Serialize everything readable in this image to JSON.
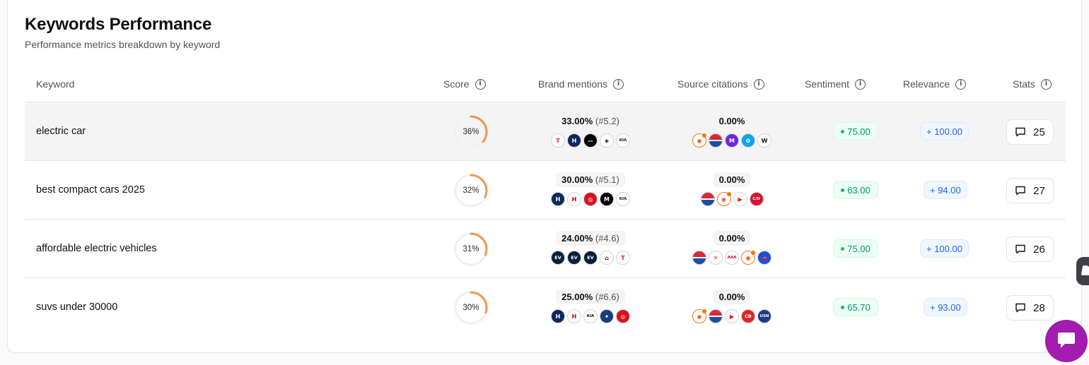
{
  "header": {
    "title": "Keywords Performance",
    "subtitle": "Performance metrics breakdown by keyword"
  },
  "columns": {
    "keyword": "Keyword",
    "score": "Score",
    "brand_mentions": "Brand mentions",
    "source_citations": "Source citations",
    "sentiment": "Sentiment",
    "relevance": "Relevance",
    "stats": "Stats"
  },
  "colors": {
    "score_ring": "#f4954f",
    "score_track": "#f1f1f3",
    "sentiment_green": "#059669",
    "relevance_blue": "#2563eb",
    "chat_fab": "#a21caf"
  },
  "rows": [
    {
      "keyword": "electric car",
      "score": 36,
      "score_label": "36%",
      "mentions": "33.00%",
      "mentions_rank": "(#5.2)",
      "brand_logos": [
        "tesla-logo",
        "hyundai-logo",
        "nissan-logo",
        "polestar-logo",
        "kia-logo"
      ],
      "citations": "0.00%",
      "source_logos": [
        "reddit-logo",
        "edmunds-logo",
        "motortrend-logo",
        "carwow-logo",
        "wikipedia-logo"
      ],
      "sentiment": "75.00",
      "relevance": "+ 100.00",
      "stats": "25"
    },
    {
      "keyword": "best compact cars 2025",
      "score": 32,
      "score_label": "32%",
      "mentions": "30.00%",
      "mentions_rank": "(#5.1)",
      "brand_logos": [
        "hyundai-logo",
        "honda-logo",
        "toyota-logo",
        "mazda-logo",
        "kia-logo"
      ],
      "citations": "0.00%",
      "source_logos": [
        "edmunds-logo",
        "reddit-logo",
        "youtube-logo",
        "caranddriver-logo"
      ],
      "sentiment": "63.00",
      "relevance": "+ 94.00",
      "stats": "27"
    },
    {
      "keyword": "affordable electric vehicles",
      "score": 31,
      "score_label": "31%",
      "mentions": "24.00%",
      "mentions_rank": "(#4.6)",
      "brand_logos": [
        "ev-logo",
        "ev-logo",
        "ev-logo",
        "home-logo",
        "tesla-logo"
      ],
      "citations": "0.00%",
      "source_logos": [
        "edmunds-logo",
        "x-logo",
        "aaa-logo",
        "reddit-logo",
        "cars-logo"
      ],
      "sentiment": "75.00",
      "relevance": "+ 100.00",
      "stats": "26"
    },
    {
      "keyword": "suvs under 30000",
      "score": 30,
      "score_label": "30%",
      "mentions": "25.00%",
      "mentions_rank": "(#6.6)",
      "brand_logos": [
        "hyundai-logo",
        "honda-logo",
        "kia-logo",
        "subaru-logo",
        "toyota-logo"
      ],
      "citations": "0.00%",
      "source_logos": [
        "reddit-logo",
        "edmunds-logo",
        "youtube-logo",
        "carbuzz-logo",
        "usnews-logo"
      ],
      "sentiment": "65.70",
      "relevance": "+ 93.00",
      "stats": "28"
    }
  ]
}
